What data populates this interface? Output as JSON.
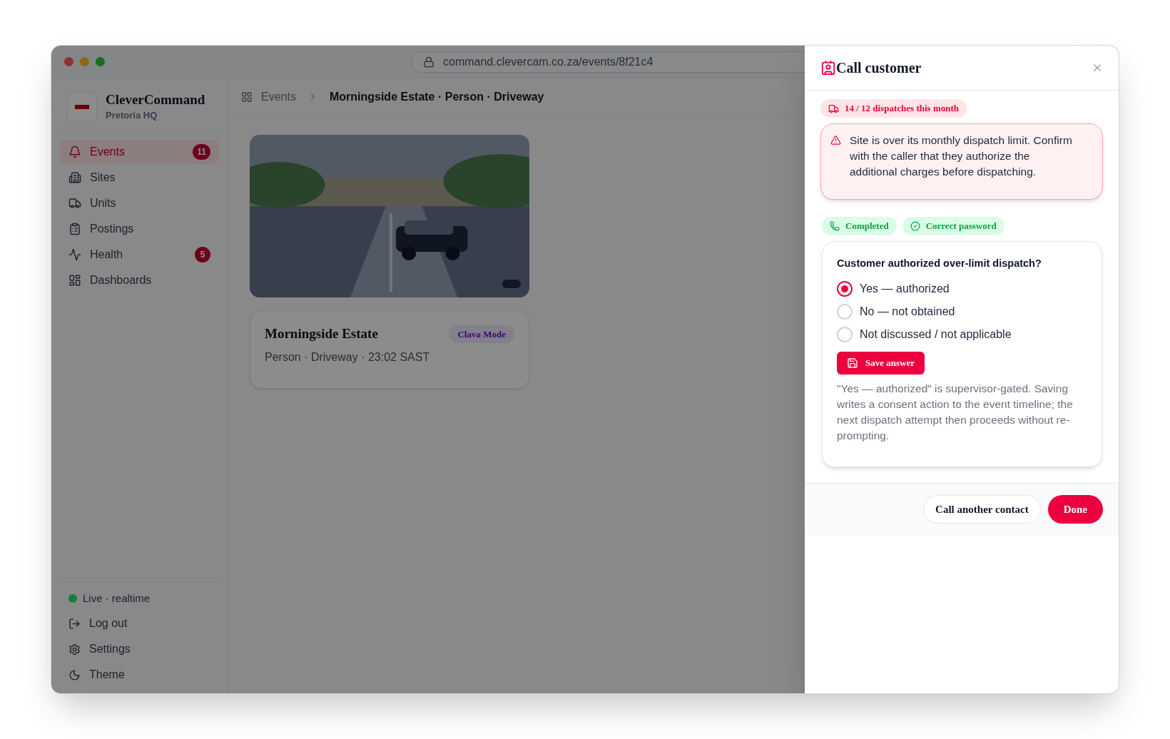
{
  "window": {
    "url": "command.clevercam.co.za/events/8f21c4"
  },
  "sidebar": {
    "brand": "CleverCommand",
    "subtitle": "Pretoria HQ",
    "items": [
      {
        "label": "Events",
        "selected": true,
        "badge": "11"
      },
      {
        "label": "Sites",
        "selected": false
      },
      {
        "label": "Units",
        "selected": false
      },
      {
        "label": "Postings",
        "selected": false
      },
      {
        "label": "Health",
        "selected": false,
        "badge": "5"
      },
      {
        "label": "Dashboards",
        "selected": false
      }
    ],
    "status": {
      "label": "Live · realtime",
      "color": "#15803d"
    },
    "footer_items": [
      "Log out",
      "Settings",
      "Theme"
    ]
  },
  "breadcrumb": [
    "Events",
    "Morningside Estate · Person · Driveway"
  ],
  "event_card": {
    "title": "Morningside Estate",
    "tag": "Clava Mode",
    "meta": "Person · Driveway · 23:02 SAST"
  },
  "modal": {
    "title": "Call customer",
    "usage_badge": "14 / 12 dispatches this month",
    "alert": "Site is over its monthly dispatch limit. Confirm with the caller that they authorize the additional charges before dispatching.",
    "chips": [
      "Completed",
      "Correct password"
    ],
    "question": "Customer authorized over-limit dispatch?",
    "options": [
      {
        "label": "Yes — authorized",
        "selected": true
      },
      {
        "label": "No — not obtained",
        "selected": false
      },
      {
        "label": "Not discussed / not applicable",
        "selected": false
      }
    ],
    "save_button": "Save answer",
    "note": "\"Yes — authorized\" is supervisor-gated. Saving writes a consent action to the event timeline; the next dispatch attempt then proceeds without re-prompting.",
    "buttons": [
      "Call another contact",
      "Done"
    ]
  }
}
